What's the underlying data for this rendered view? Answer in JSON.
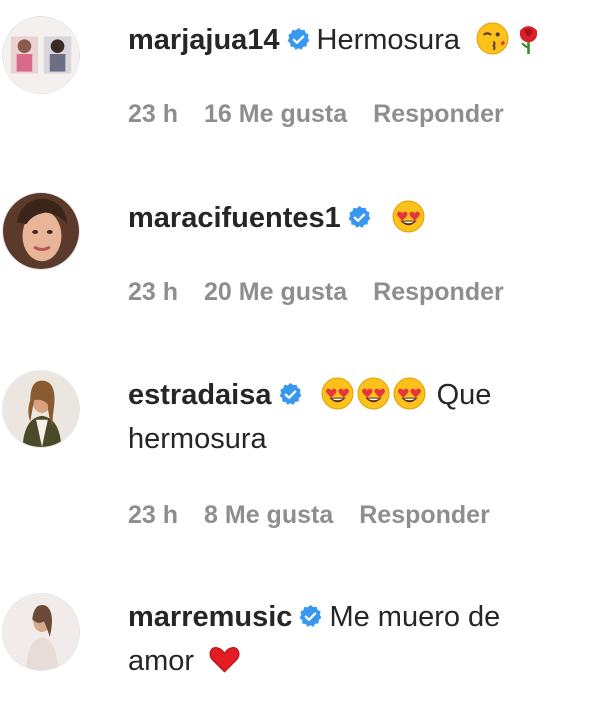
{
  "comments": [
    {
      "username": "marjajua14",
      "verified": true,
      "text": "Hermosura",
      "emojis": [
        "winking-kiss-emoji",
        "rose-emoji"
      ],
      "time": "23 h",
      "likes": "16 Me gusta",
      "reply": "Responder"
    },
    {
      "username": "maracifuentes1",
      "verified": true,
      "text": "",
      "emojis": [
        "heart-eyes-emoji"
      ],
      "time": "23 h",
      "likes": "20 Me gusta",
      "reply": "Responder"
    },
    {
      "username": "estradaisa",
      "verified": true,
      "text_line1": "Que",
      "text_line2": "hermosura",
      "emojis": [
        "heart-eyes-emoji",
        "heart-eyes-emoji",
        "heart-eyes-emoji"
      ],
      "time": "23 h",
      "likes": "8 Me gusta",
      "reply": "Responder"
    },
    {
      "username": "marremusic",
      "verified": true,
      "text_line1": "Me muero de",
      "text_line2": "amor",
      "emojis": [
        "red-heart-emoji"
      ],
      "time": "",
      "likes": "",
      "reply": ""
    }
  ],
  "colors": {
    "verified": "#3897f0",
    "meta": "#8e8e8e",
    "text": "#262626"
  }
}
